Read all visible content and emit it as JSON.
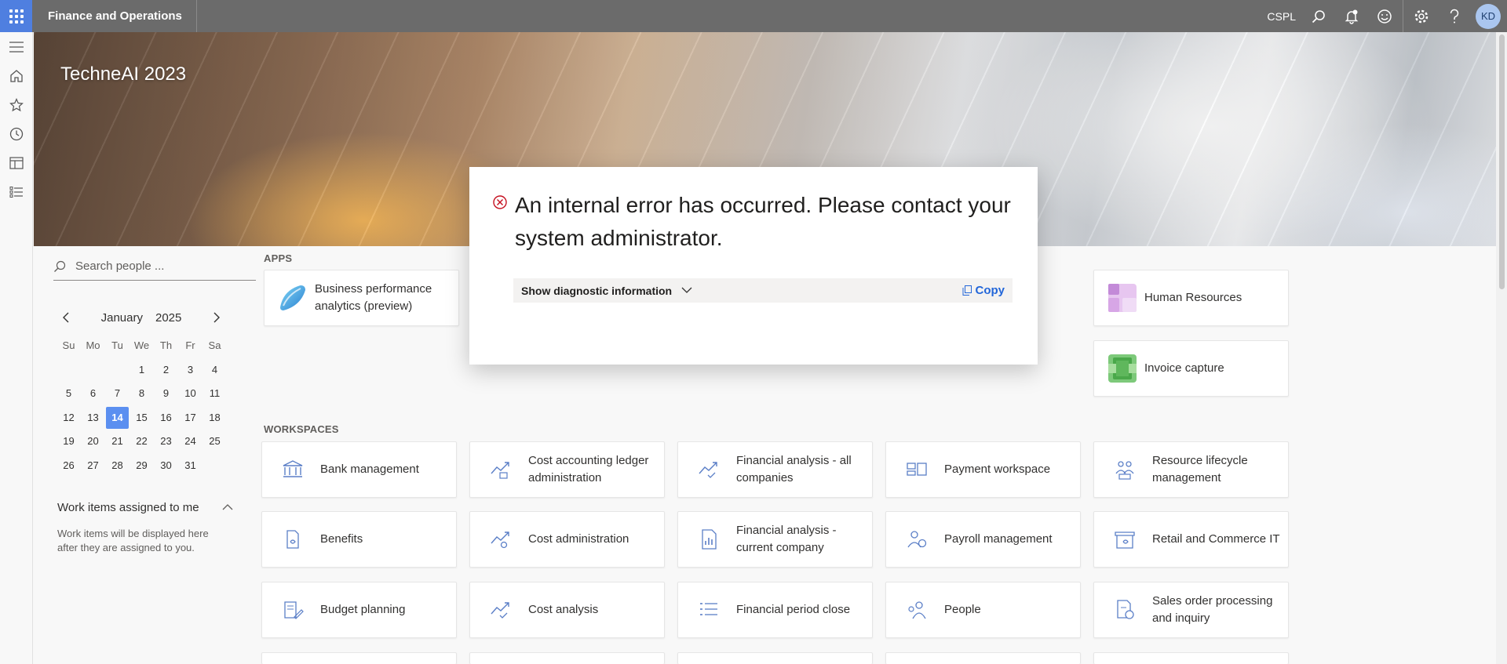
{
  "topbar": {
    "app_title": "Finance and Operations",
    "company": "CSPL",
    "avatar_initials": "KD",
    "icons": [
      "waffle-icon",
      "search-icon",
      "notifications-icon",
      "feedback-icon",
      "settings-icon",
      "help-icon"
    ]
  },
  "leftnav": {
    "icons": [
      "hamburger-icon",
      "home-icon",
      "favorites-icon",
      "recent-icon",
      "workspaces-icon",
      "modules-icon"
    ]
  },
  "banner": {
    "title": "TechneAI 2023"
  },
  "people_search": {
    "placeholder": "Search people ..."
  },
  "calendar": {
    "month": "January",
    "year": "2025",
    "days_of_week": [
      "Su",
      "Mo",
      "Tu",
      "We",
      "Th",
      "Fr",
      "Sa"
    ],
    "weeks": [
      [
        "",
        "",
        "",
        "1",
        "2",
        "3",
        "4"
      ],
      [
        "5",
        "6",
        "7",
        "8",
        "9",
        "10",
        "11"
      ],
      [
        "12",
        "13",
        "14",
        "15",
        "16",
        "17",
        "18"
      ],
      [
        "19",
        "20",
        "21",
        "22",
        "23",
        "24",
        "25"
      ],
      [
        "26",
        "27",
        "28",
        "29",
        "30",
        "31",
        ""
      ]
    ],
    "selected_day": "14"
  },
  "work_items": {
    "title": "Work items assigned to me",
    "empty_text": "Work items will be displayed here after they are assigned to you."
  },
  "apps": {
    "label": "APPS",
    "tiles": [
      {
        "label": "Business performance analytics (preview)",
        "icon": "bpa-logo"
      },
      {
        "label": "Human Resources",
        "icon": "hr-logo"
      },
      {
        "label": "Invoice capture",
        "icon": "invoice-capture-logo"
      }
    ]
  },
  "workspaces": {
    "label": "WORKSPACES",
    "tiles": [
      {
        "label": "Bank management",
        "icon": "bank-icon"
      },
      {
        "label": "Cost accounting ledger administration",
        "icon": "trend-ledger-icon"
      },
      {
        "label": "Financial analysis - all companies",
        "icon": "trend-check-icon"
      },
      {
        "label": "Payment workspace",
        "icon": "payment-icon"
      },
      {
        "label": "Resource lifecycle management",
        "icon": "people-group-icon"
      },
      {
        "label": "Benefits",
        "icon": "benefits-icon"
      },
      {
        "label": "Cost administration",
        "icon": "trend-gear-icon"
      },
      {
        "label": "Financial analysis - current company",
        "icon": "report-chart-icon"
      },
      {
        "label": "Payroll management",
        "icon": "payroll-icon"
      },
      {
        "label": "Retail and Commerce IT",
        "icon": "store-icon"
      },
      {
        "label": "Budget planning",
        "icon": "budget-icon"
      },
      {
        "label": "Cost analysis",
        "icon": "trend-check-icon"
      },
      {
        "label": "Financial period close",
        "icon": "checklist-icon"
      },
      {
        "label": "People",
        "icon": "people-icon"
      },
      {
        "label": "Sales order processing and inquiry",
        "icon": "sales-order-icon"
      }
    ]
  },
  "error_dialog": {
    "message": "An internal error has occurred. Please contact your system administrator.",
    "diagnostic_label": "Show diagnostic information",
    "copy_label": "Copy",
    "error_color": "#c50f1f",
    "link_color": "#2266d9"
  }
}
